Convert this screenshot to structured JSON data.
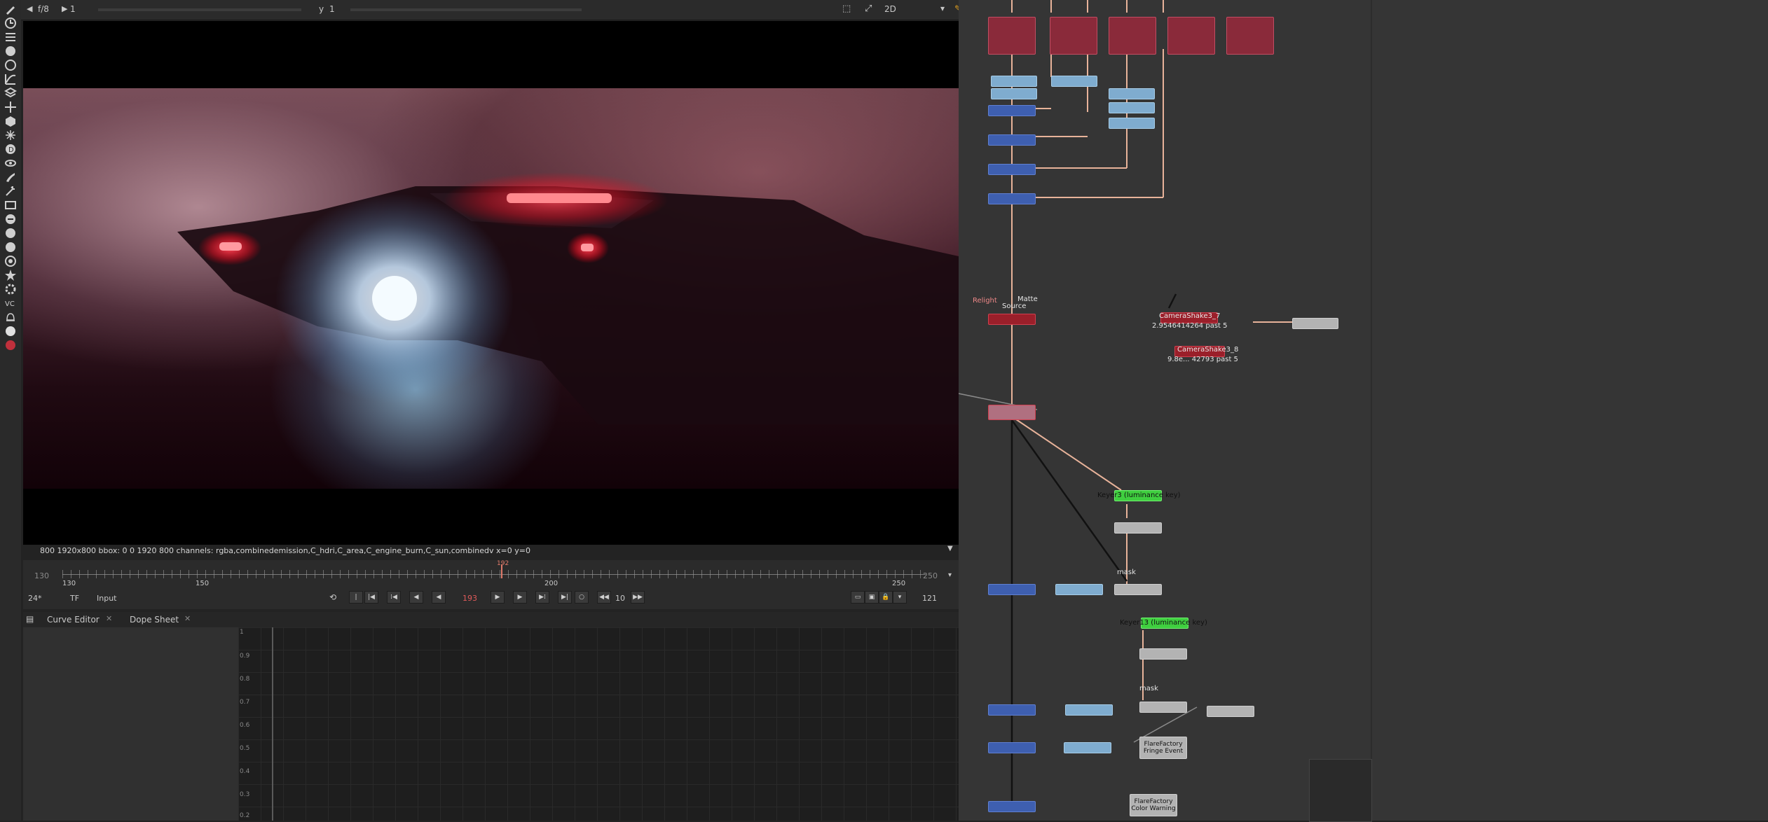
{
  "viewer": {
    "frame_label": "f/8",
    "frame_value": "1",
    "y_label": "y",
    "y_value": "1",
    "view_mode": "2D",
    "info_text": "800 1920x800  bbox: 0 0 1920 800 channels: rgba,combinedemission,C_hdri,C_area,C_engine_burn,C_sun,combinedv  x=0 y=0"
  },
  "timeline": {
    "start": "130",
    "end": "250",
    "ticks": [
      "130",
      "150",
      "200",
      "250"
    ],
    "marker_label": "192",
    "fps": "24*",
    "tf": "TF",
    "input": "Input",
    "current_frame": "193",
    "step": "10",
    "end_frame": "121"
  },
  "tabs": [
    {
      "label": "Curve Editor"
    },
    {
      "label": "Dope Sheet"
    }
  ],
  "curve_editor": {
    "y_labels": [
      "1",
      "0.9",
      "0.8",
      "0.7",
      "0.6",
      "0.5",
      "0.4",
      "0.3",
      "0.2"
    ]
  },
  "nodegraph": {
    "labels": {
      "camera_shake_1_name": "CameraShake3_7",
      "camera_shake_1_value": "2.9546414264 past 5",
      "camera_shake_2_name": "CameraShake3_8",
      "camera_shake_2_value": "9.8e... 42793 past 5",
      "relight_label": "Relight",
      "matte_label": "Matte",
      "source_label": "Source",
      "keyer_1_label": "Keyer3 (luminance key)",
      "keyer_2_label": "Keyer13 (luminance key)",
      "mask_label_1": "mask",
      "mask_label_2": "mask",
      "flare_1_line1": "FlareFactory",
      "flare_1_line2": "Fringe Event",
      "flare_2_line1": "FlareFactory",
      "flare_2_line2": "Color Warning"
    }
  },
  "colors": {
    "accent_red": "#c24d62",
    "node_blue": "#3e5fb0",
    "node_green": "#3fcf3f",
    "pipe": "#e8b39a"
  }
}
